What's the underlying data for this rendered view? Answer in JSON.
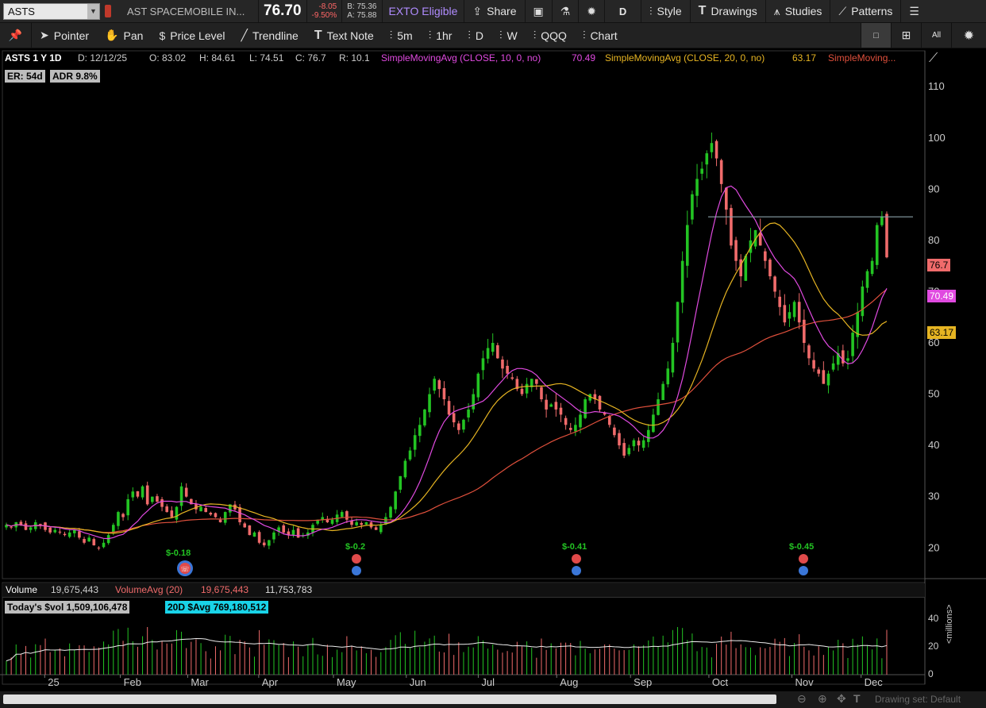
{
  "top": {
    "symbol": "ASTS",
    "company": "AST SPACEMOBILE IN...",
    "last": "76.70",
    "change": "-8.05",
    "change_pct": "-9.50%",
    "bid": "B: 75.36",
    "ask": "A: 75.88",
    "exto": "EXTO Eligible",
    "share": "Share",
    "period": "D",
    "style": "Style",
    "drawings": "Drawings",
    "studies": "Studies",
    "patterns": "Patterns"
  },
  "tools": {
    "pointer": "Pointer",
    "pan": "Pan",
    "price_level": "Price Level",
    "trendline": "Trendline",
    "text_note": "Text Note",
    "t5m": "5m",
    "t1hr": "1hr",
    "td": "D",
    "tw": "W",
    "qqq": "QQQ",
    "chart": "Chart",
    "all": "All"
  },
  "header": {
    "title": "ASTS 1 Y 1D",
    "date": "D: 12/12/25",
    "open": "O: 83.02",
    "high": "H: 84.61",
    "low": "L: 74.51",
    "close": "C: 76.7",
    "range": "R: 10.1",
    "sma10": "SimpleMovingAvg (CLOSE, 10, 0, no)",
    "sma10_val": "70.49",
    "sma20": "SimpleMovingAvg (CLOSE, 20, 0, no)",
    "sma20_val": "63.17",
    "sma50": "SimpleMoving...",
    "er": "ER: 54d",
    "adr": "ADR 9.8%"
  },
  "price_badges": {
    "last": "76.7",
    "sma10": "70.49",
    "sma20": "63.17"
  },
  "earnings": [
    {
      "label": "$-0.18",
      "icon": "earnings-bubble-icon"
    },
    {
      "label": "$-0.2",
      "icon": "earnings-icon"
    },
    {
      "label": "$-0.41",
      "icon": "earnings-icon"
    },
    {
      "label": "$-0.45",
      "icon": "earnings-icon"
    }
  ],
  "volume": {
    "title": "Volume",
    "value": "19,675,443",
    "avg_label": "VolumeAvg (20)",
    "avg_value": "19,675,443",
    "avg_value2": "11,753,783",
    "today_dvol": "Today's $vol 1,509,106,478",
    "avg_dvol": "20D $Avg 769,180,512",
    "unit": "<millions>",
    "ticks": [
      "40",
      "20",
      "0"
    ]
  },
  "footer": {
    "drawing_set": "Drawing set: Default"
  },
  "colors": {
    "up": "#23c423",
    "down": "#f06b6b",
    "sma10": "#e04ae0",
    "sma20": "#e6b422",
    "sma50": "#e0503c",
    "price_line": "#8aa0a8"
  },
  "chart_data": {
    "type": "candlestick",
    "title": "ASTS 1 Y 1D",
    "x_ticks": [
      "25",
      "Feb",
      "Mar",
      "Apr",
      "May",
      "Jun",
      "Jul",
      "Aug",
      "Sep",
      "Oct",
      "Nov",
      "Dec"
    ],
    "y_ticks": [
      20,
      30,
      40,
      50,
      60,
      70,
      80,
      90,
      100,
      110
    ],
    "ylim": [
      14,
      117
    ],
    "horizontal_line": 84.6,
    "closes": [
      24.5,
      24.0,
      25.0,
      24.5,
      23.5,
      24.0,
      25.0,
      24.5,
      23.5,
      23.0,
      23.5,
      23.0,
      22.5,
      23.0,
      23.5,
      22.0,
      21.0,
      22.0,
      20.5,
      20.0,
      21.0,
      22.5,
      24.5,
      27.0,
      26.0,
      29.5,
      31.0,
      30.0,
      32.0,
      28.5,
      30.0,
      29.0,
      28.0,
      27.0,
      26.0,
      28.0,
      32.0,
      30.0,
      28.5,
      27.5,
      28.0,
      27.0,
      26.5,
      26.0,
      25.0,
      27.0,
      28.5,
      27.5,
      25.0,
      24.0,
      22.5,
      23.0,
      21.0,
      20.5,
      21.5,
      23.0,
      24.0,
      23.0,
      22.5,
      23.5,
      22.0,
      22.5,
      23.0,
      24.5,
      25.5,
      26.0,
      25.0,
      25.5,
      26.5,
      27.0,
      25.5,
      24.5,
      25.0,
      24.5,
      25.0,
      24.0,
      23.5,
      24.5,
      26.0,
      28.0,
      31.0,
      34.0,
      37.0,
      39.0,
      42.0,
      44.0,
      47.0,
      50.0,
      53.0,
      51.0,
      49.0,
      46.0,
      44.5,
      43.0,
      45.0,
      47.0,
      50.0,
      54.0,
      57.0,
      59.0,
      60.0,
      57.0,
      55.0,
      54.0,
      53.0,
      51.0,
      50.0,
      52.0,
      53.0,
      52.0,
      49.0,
      47.0,
      48.0,
      47.0,
      46.0,
      44.0,
      43.0,
      44.0,
      46.0,
      49.0,
      50.0,
      49.0,
      47.0,
      46.0,
      44.0,
      42.0,
      40.0,
      38.0,
      39.5,
      41.0,
      40.0,
      41.0,
      43.0,
      46.0,
      49.0,
      52.0,
      55.0,
      60.0,
      68.0,
      76.0,
      83.0,
      89.0,
      92.0,
      94.0,
      97.0,
      99.0,
      96.0,
      91.0,
      86.0,
      79.0,
      76.0,
      73.0,
      77.0,
      80.0,
      82.0,
      79.0,
      76.0,
      73.0,
      70.0,
      67.0,
      64.0,
      66.0,
      68.0,
      64.0,
      60.0,
      57.0,
      55.0,
      54.0,
      52.0,
      54.0,
      56.0,
      58.0,
      56.0,
      57.0,
      62.0,
      66.0,
      71.0,
      74.0,
      76.0,
      83.0,
      84.7,
      76.7
    ]
  }
}
